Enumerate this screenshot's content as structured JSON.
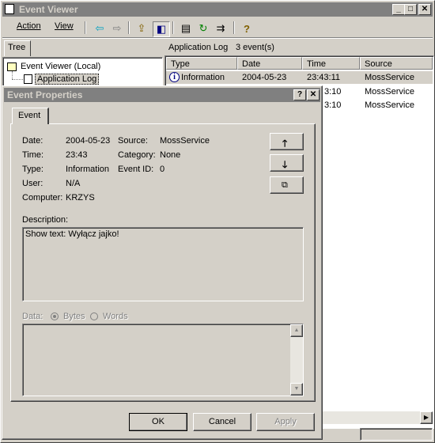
{
  "main_window": {
    "title": "Event Viewer",
    "controls": {
      "minimize": "_",
      "maximize": "□",
      "close": "✕"
    },
    "menu": {
      "action": "Action",
      "view": "View"
    },
    "toolbar": [
      "back-icon",
      "forward-icon",
      "up-folder-icon",
      "show-hide-tree-icon",
      "properties-icon",
      "refresh-icon",
      "export-list-icon",
      "help-icon"
    ]
  },
  "tree": {
    "tab": "Tree",
    "root": "Event Viewer (Local)",
    "child": "Application Log"
  },
  "log_pane": {
    "name": "Application Log",
    "count": "3 event(s)",
    "columns": [
      "Type",
      "Date",
      "Time",
      "Source"
    ],
    "rows": [
      {
        "type": "Information",
        "date": "2004-05-23",
        "time": "23:43:11",
        "source": "MossService"
      },
      {
        "time_partial": "3:10",
        "source": "MossService"
      },
      {
        "time_partial": "3:10",
        "source": "MossService"
      }
    ]
  },
  "dialog": {
    "title": "Event Properties",
    "help": "?",
    "close": "✕",
    "tab": "Event",
    "fields": {
      "date_label": "Date:",
      "date_value": "2004-05-23",
      "source_label": "Source:",
      "source_value": "MossService",
      "time_label": "Time:",
      "time_value": "23:43",
      "category_label": "Category:",
      "category_value": "None",
      "type_label": "Type:",
      "type_value": "Information",
      "eventid_label": "Event ID:",
      "eventid_value": "0",
      "user_label": "User:",
      "user_value": "N/A",
      "computer_label": "Computer:",
      "computer_value": "KRZYS"
    },
    "description_label": "Description:",
    "description_text": "Show text: Wyłącz jajko!",
    "data_label": "Data:",
    "bytes_label": "Bytes",
    "words_label": "Words",
    "buttons": {
      "ok": "OK",
      "cancel": "Cancel",
      "apply": "Apply"
    }
  }
}
